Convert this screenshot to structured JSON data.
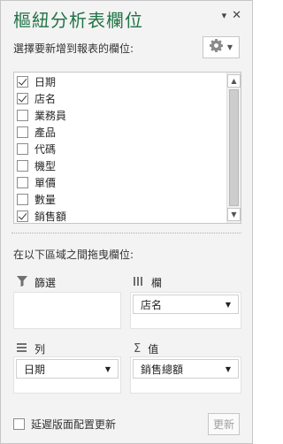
{
  "pane": {
    "title": "樞紐分析表欄位",
    "dropdown_glyph": "▾",
    "close_glyph": "✕"
  },
  "prompt": "選擇要新增到報表的欄位:",
  "fields": [
    {
      "label": "日期",
      "checked": true
    },
    {
      "label": "店名",
      "checked": true
    },
    {
      "label": "業務員",
      "checked": false
    },
    {
      "label": "產品",
      "checked": false
    },
    {
      "label": "代碼",
      "checked": false
    },
    {
      "label": "機型",
      "checked": false
    },
    {
      "label": "單價",
      "checked": false
    },
    {
      "label": "數量",
      "checked": false
    },
    {
      "label": "銷售額",
      "checked": true
    }
  ],
  "drag_prompt": "在以下區域之間拖曳欄位:",
  "areas": {
    "filters": {
      "label": "篩選",
      "icon": "filter-icon",
      "items": []
    },
    "columns": {
      "label": "欄",
      "icon": "columns-icon",
      "items": [
        "店名"
      ]
    },
    "rows": {
      "label": "列",
      "icon": "rows-icon",
      "items": [
        "日期"
      ]
    },
    "values": {
      "label": "值",
      "icon": "sigma-icon",
      "symbol": "Σ",
      "items": [
        "銷售總額"
      ]
    }
  },
  "bottom": {
    "defer_label": "延遲版面配置更新",
    "defer_checked": false,
    "update_label": "更新"
  },
  "colors": {
    "title": "#217346",
    "pane_bg": "#f3f3f3"
  }
}
